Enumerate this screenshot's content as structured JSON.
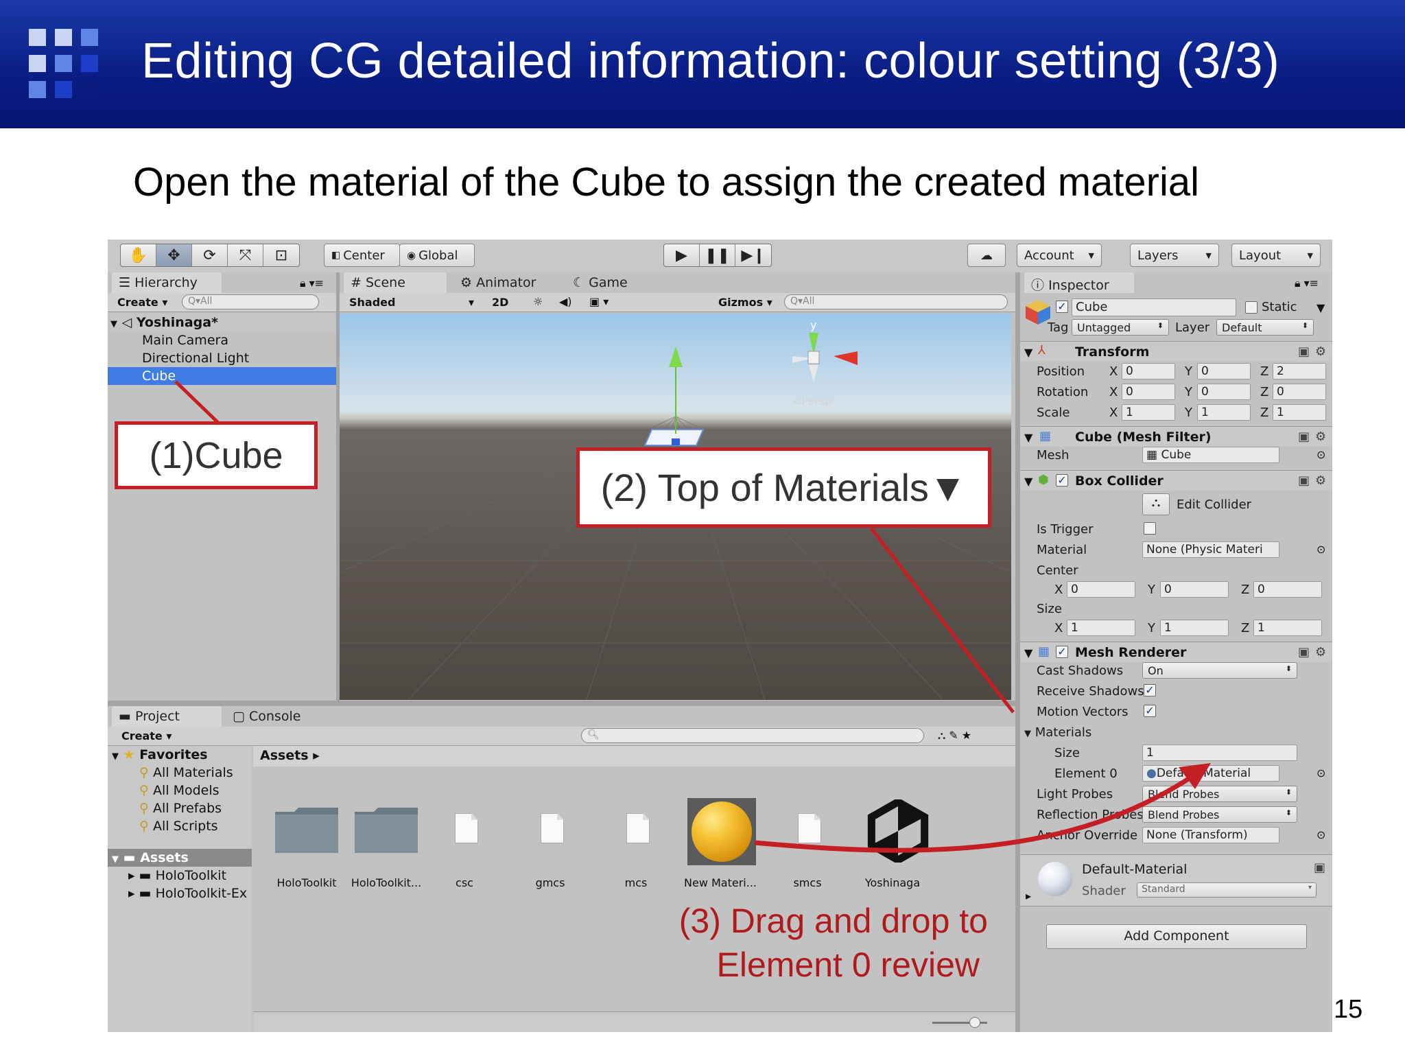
{
  "slide": {
    "title": "Editing CG detailed information: colour setting (3/3)",
    "subtitle": "Open the material of the Cube to assign the created material",
    "page_number": "15"
  },
  "colors": {
    "header_blue": "#0a1e86",
    "callout_red": "#c41f25",
    "selection_blue": "#3e7de3"
  },
  "toolbar": {
    "pivot_label": "Center",
    "space_label": "Global",
    "account_label": "Account",
    "layers_label": "Layers",
    "layout_label": "Layout",
    "tools": [
      "hand-icon",
      "move-icon",
      "rotate-icon",
      "scale-icon",
      "rect-icon"
    ],
    "playback": [
      "play-icon",
      "pause-icon",
      "step-icon"
    ]
  },
  "hierarchy": {
    "tab_label": "Hierarchy",
    "create_label": "Create",
    "search_placeholder": "Q▾All",
    "scene_name": "Yoshinaga*",
    "items": [
      "Main Camera",
      "Directional Light",
      "Cube"
    ],
    "selected_item": "Cube"
  },
  "scene": {
    "tabs": [
      "Scene",
      "Animator",
      "Game"
    ],
    "shading_label": "Shaded",
    "mode_2d_label": "2D",
    "gizmos_label": "Gizmos",
    "search_placeholder": "Q▾All",
    "persp_label": "<Persp",
    "gizmo_y_label": "y"
  },
  "project": {
    "tabs": [
      "Project",
      "Console"
    ],
    "create_label": "Create",
    "favorites_label": "Favorites",
    "favorites": [
      "All Materials",
      "All Models",
      "All Prefabs",
      "All Scripts"
    ],
    "assets_root_label": "Assets",
    "asset_folders": [
      "HoloToolkit",
      "HoloToolkit-Ex"
    ],
    "breadcrumb": "Assets",
    "assets": [
      {
        "name": "HoloToolkit",
        "kind": "folder"
      },
      {
        "name": "HoloToolkit...",
        "kind": "folder"
      },
      {
        "name": "csc",
        "kind": "file"
      },
      {
        "name": "gmcs",
        "kind": "file"
      },
      {
        "name": "mcs",
        "kind": "file"
      },
      {
        "name": "New Materi...",
        "kind": "material"
      },
      {
        "name": "smcs",
        "kind": "file"
      },
      {
        "name": "Yoshinaga",
        "kind": "unity-scene"
      }
    ]
  },
  "inspector": {
    "tab_label": "Inspector",
    "object_name": "Cube",
    "static_label": "Static",
    "tag_label": "Tag",
    "tag_value": "Untagged",
    "layer_label": "Layer",
    "layer_value": "Default",
    "transform": {
      "title": "Transform",
      "position_label": "Position",
      "position": [
        "0",
        "0",
        "2"
      ],
      "rotation_label": "Rotation",
      "rotation": [
        "0",
        "0",
        "0"
      ],
      "scale_label": "Scale",
      "scale": [
        "1",
        "1",
        "1"
      ]
    },
    "mesh_filter": {
      "title": "Cube (Mesh Filter)",
      "mesh_label": "Mesh",
      "mesh_value": "Cube"
    },
    "box_collider": {
      "title": "Box Collider",
      "edit_collider_label": "Edit Collider",
      "is_trigger_label": "Is Trigger",
      "material_label": "Material",
      "material_value": "None (Physic Materi",
      "center_label": "Center",
      "center": [
        "0",
        "0",
        "0"
      ],
      "size_label": "Size",
      "size": [
        "1",
        "1",
        "1"
      ]
    },
    "mesh_renderer": {
      "title": "Mesh Renderer",
      "cast_shadows_label": "Cast Shadows",
      "cast_shadows_value": "On",
      "receive_shadows_label": "Receive Shadows",
      "motion_vectors_label": "Motion Vectors",
      "materials_label": "Materials",
      "size_label": "Size",
      "size_value": "1",
      "element0_label": "Element 0",
      "element0_value": "Default-Material",
      "light_probes_label": "Light Probes",
      "light_probes_value": "Blend Probes",
      "reflection_probes_label": "Reflection Probes",
      "reflection_probes_value": "Blend Probes",
      "anchor_override_label": "Anchor Override",
      "anchor_override_value": "None (Transform)"
    },
    "material_preview": {
      "name": "Default-Material",
      "shader_label": "Shader",
      "shader_value": "Standard"
    },
    "add_component_label": "Add Component",
    "axis_labels": [
      "X",
      "Y",
      "Z"
    ]
  },
  "callouts": {
    "step1": "(1)Cube",
    "step2": "(2) Top of Materials▼",
    "step3_line1": "(3) Drag and drop to",
    "step3_line2": "Element 0 review"
  }
}
